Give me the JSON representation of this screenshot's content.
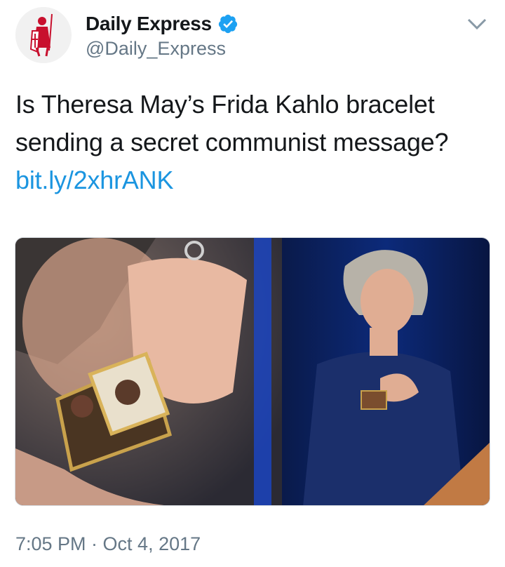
{
  "account": {
    "display_name": "Daily Express",
    "handle": "@Daily_Express",
    "verified": true,
    "avatar_icon": "crusader-logo-icon"
  },
  "tweet": {
    "text_line_1": "Is Theresa May’s Frida Kahlo bracelet",
    "text_line_2": "sending a secret communist message?",
    "link": "bit.ly/2xhrANK",
    "timestamp": "7:05 PM · Oct 4, 2017"
  },
  "media": {
    "description_icon": "photo-collage-image"
  },
  "colors": {
    "link": "#1b95e0",
    "verified": "#1da1f2",
    "secondary_text": "#657786",
    "brand_red": "#c8102e"
  }
}
